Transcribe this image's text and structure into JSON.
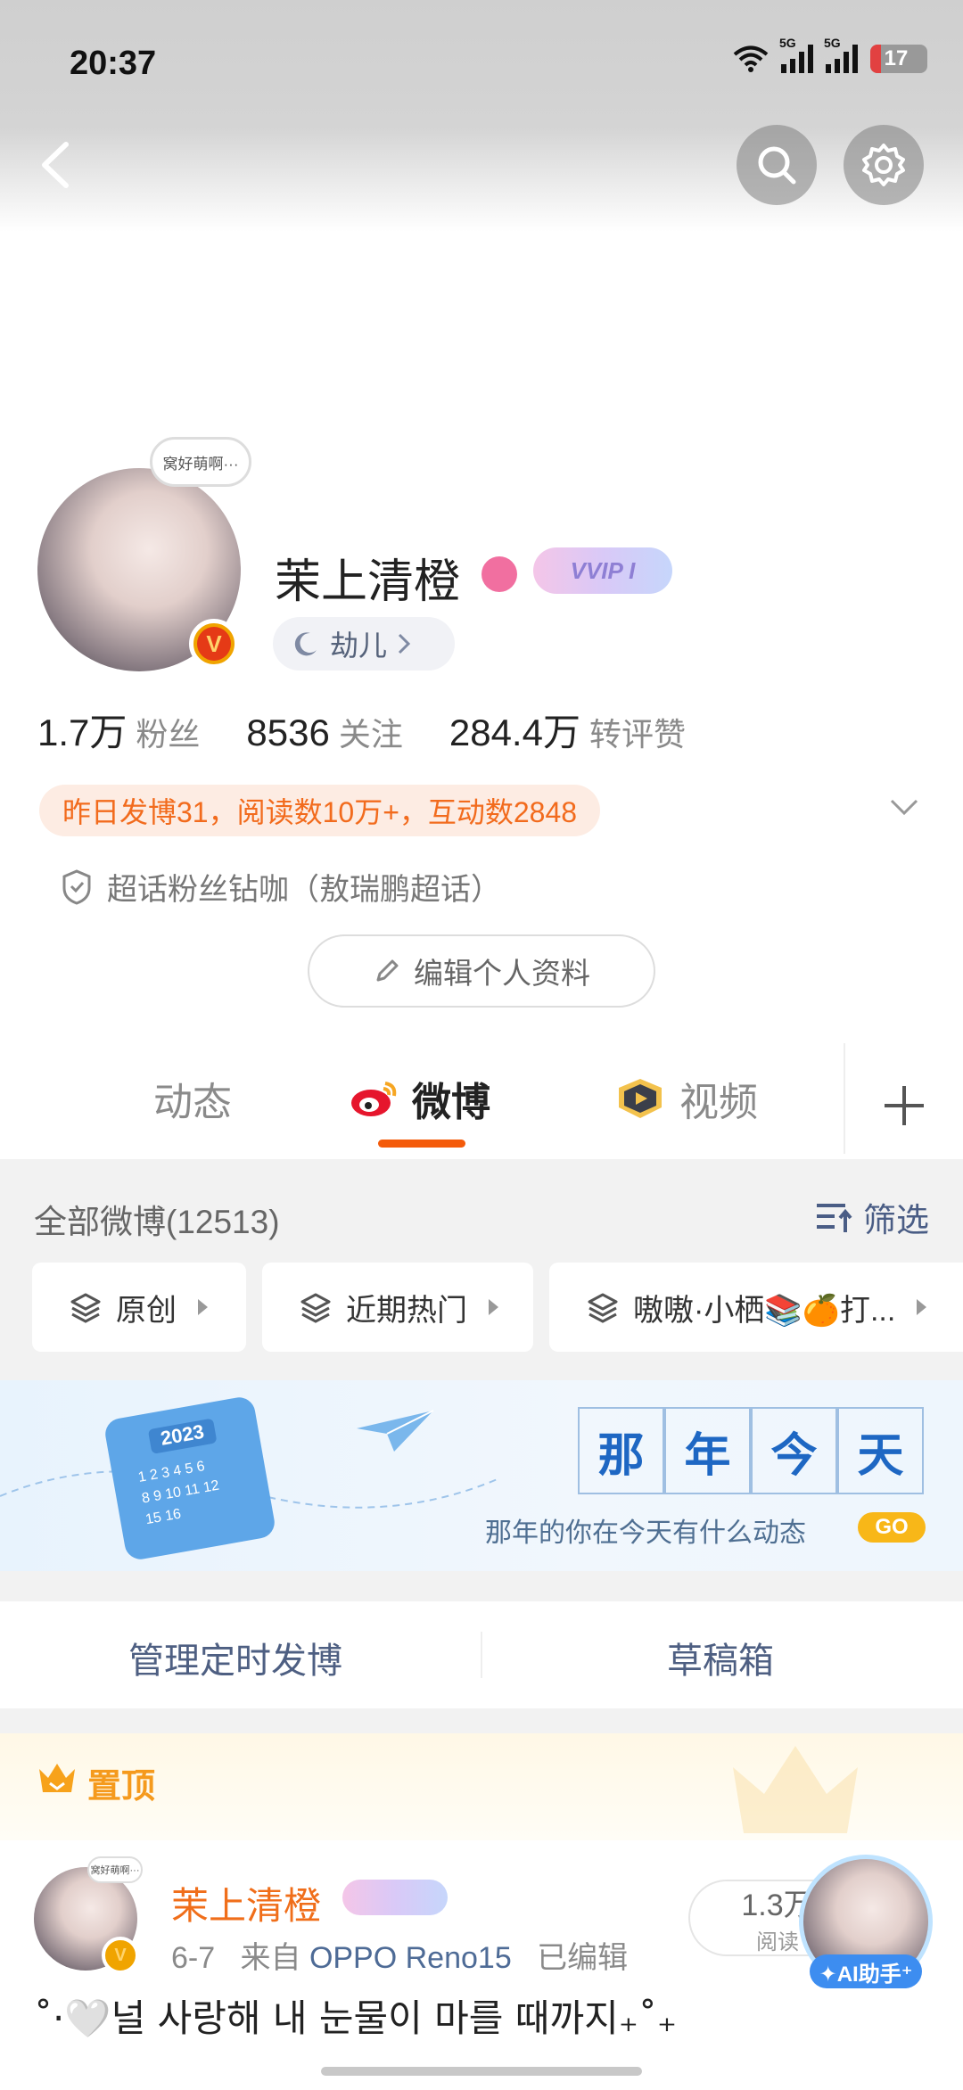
{
  "status_bar": {
    "time": "20:37",
    "network1": "5G",
    "network2": "5G",
    "battery": "17"
  },
  "profile": {
    "avatar_bubble": "窝好萌啊···",
    "name": "茉上清橙",
    "vip_label": "VVIP I",
    "tag": "劫儿",
    "stats": [
      {
        "value": "1.7万",
        "label": "粉丝"
      },
      {
        "value": "8536",
        "label": "关注"
      },
      {
        "value": "284.4万",
        "label": "转评赞"
      }
    ],
    "hot_info": "昨日发博31，阅读数10万+，互动数2848",
    "super_topic": "超话粉丝钻咖（敖瑞鹏超话）",
    "edit_label": "编辑个人资料"
  },
  "tabs": [
    {
      "label": "动态"
    },
    {
      "label": "微博"
    },
    {
      "label": "视频"
    }
  ],
  "feed": {
    "all_count": "全部微博(12513)",
    "filter_label": "筛选",
    "chips": [
      "原创",
      "近期热门",
      "嗷嗷·小栖📚🍊打..."
    ]
  },
  "banner": {
    "year": "2023",
    "title_chars": [
      "那",
      "年",
      "今",
      "天"
    ],
    "subtitle": "那年的你在今天有什么动态",
    "go_label": "GO"
  },
  "manage": {
    "left": "管理定时发博",
    "right": "草稿箱"
  },
  "pinned": {
    "label": "置顶",
    "avatar_bubble": "窝好萌啊···",
    "name": "茉上清橙",
    "date": "6-7",
    "from": "来自",
    "device": "OPPO Reno15",
    "edited": "已编辑",
    "reads_count": "1.3万",
    "reads_label": "阅读",
    "text": "˚·🤍널 사랑해 내 눈물이 마를 때까지₊˚₊"
  },
  "ai_helper": {
    "label": "✦AI助手⁺"
  },
  "colors": {
    "accent": "#f45b0a",
    "link": "#4e5f82",
    "orange_text": "#f26b1d"
  }
}
